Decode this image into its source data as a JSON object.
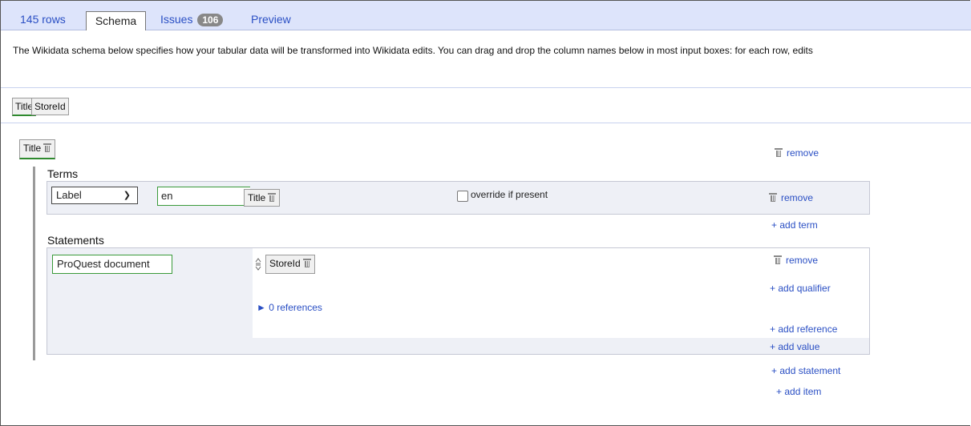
{
  "tabs": {
    "rows": "145 rows",
    "schema": "Schema",
    "issues": "Issues",
    "issues_count": "106",
    "preview": "Preview"
  },
  "description": "The Wikidata schema below specifies how your tabular data will be transformed into Wikidata edits. You can drag and drop the column names below in most input boxes: for each row, edits",
  "columns": [
    "Title",
    "StoreId"
  ],
  "item": {
    "subject": "Title",
    "remove": "remove",
    "terms_heading": "Terms",
    "term": {
      "type": "Label",
      "language": "en",
      "value": "Title",
      "override": "override if present",
      "remove": "remove"
    },
    "add_term": "+ add term",
    "statements_heading": "Statements",
    "statement": {
      "property": "ProQuest document",
      "value": "StoreId",
      "remove": "remove",
      "add_qualifier": "+ add qualifier",
      "references": "► 0 references",
      "add_reference": "+ add reference",
      "add_value": "+ add value"
    },
    "add_statement": "+ add statement"
  },
  "add_item": "+ add item",
  "colors": {
    "tab_bg": "#dde4fb",
    "link": "#2a4fc4",
    "green": "#2f8a2f",
    "box_bg": "#eef0f6"
  }
}
